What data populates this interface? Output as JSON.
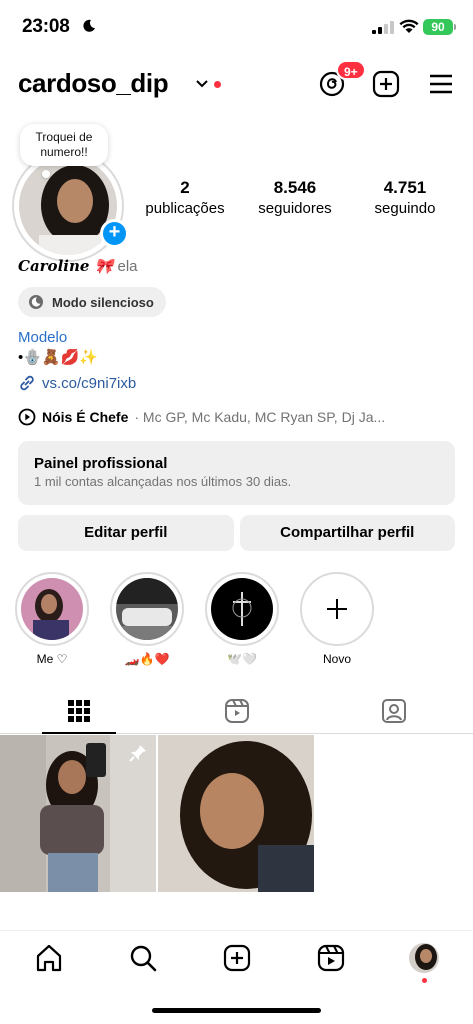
{
  "status_bar": {
    "time": "23:08",
    "battery": "90"
  },
  "header": {
    "username": "cardoso_dip",
    "threads_badge": "9+"
  },
  "profile": {
    "note": "Troquei de numero!!",
    "stats": [
      {
        "value": "2",
        "label": "publicações"
      },
      {
        "value": "8.546",
        "label": "seguidores"
      },
      {
        "value": "4.751",
        "label": "seguindo"
      }
    ],
    "display_name": "Caroline 🎀",
    "pronoun": "ela",
    "silent_mode": "Modo silencioso",
    "category": "Modelo",
    "bio": "•🪬🧸💋✨",
    "link": "vs.co/c9ni7ixb",
    "music_title": "Nóis É Chefe",
    "music_artists": "· Mc GP, Mc Kadu, MC Ryan SP, Dj Ja..."
  },
  "professional_panel": {
    "title": "Painel profissional",
    "subtitle": "1 mil contas alcançadas nos últimos 30 dias."
  },
  "actions": {
    "edit": "Editar perfil",
    "share": "Compartilhar perfil"
  },
  "highlights": [
    {
      "label": "Me ♡"
    },
    {
      "label": "🏎️🔥❤️"
    },
    {
      "label": "🕊️🤍"
    },
    {
      "label": "Novo"
    }
  ]
}
